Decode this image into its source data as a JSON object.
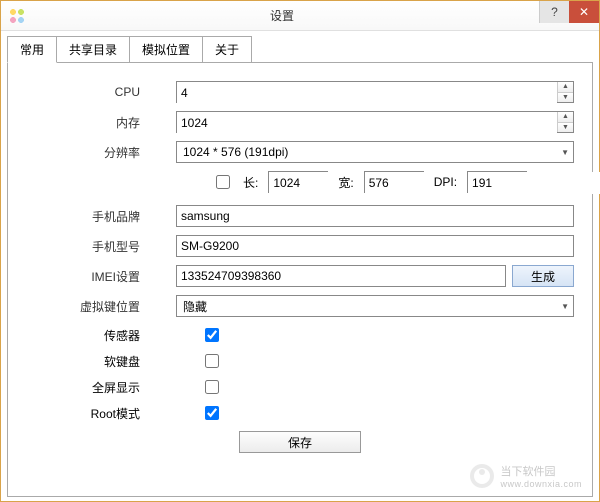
{
  "window": {
    "title": "设置"
  },
  "tabs": [
    {
      "label": "常用"
    },
    {
      "label": "共享目录"
    },
    {
      "label": "模拟位置"
    },
    {
      "label": "关于"
    }
  ],
  "form": {
    "cpu_label": "CPU",
    "cpu_value": "4",
    "mem_label": "内存",
    "mem_value": "1024",
    "res_label": "分辨率",
    "res_value": "1024 * 576 (191dpi)",
    "custom_checked": false,
    "len_label": "长:",
    "len_value": "1024",
    "wid_label": "宽:",
    "wid_value": "576",
    "dpi_label": "DPI:",
    "dpi_value": "191",
    "brand_label": "手机品牌",
    "brand_value": "samsung",
    "model_label": "手机型号",
    "model_value": "SM-G9200",
    "imei_label": "IMEI设置",
    "imei_value": "133524709398360",
    "gen_button": "生成",
    "vkey_label": "虚拟键位置",
    "vkey_value": "隐藏",
    "sensor_label": "传感器",
    "sensor_checked": true,
    "softkb_label": "软键盘",
    "softkb_checked": false,
    "fullscreen_label": "全屏显示",
    "fullscreen_checked": false,
    "root_label": "Root模式",
    "root_checked": true,
    "save_button": "保存"
  },
  "watermark": {
    "brand": "当下软件园",
    "url": "www.downxia.com"
  }
}
